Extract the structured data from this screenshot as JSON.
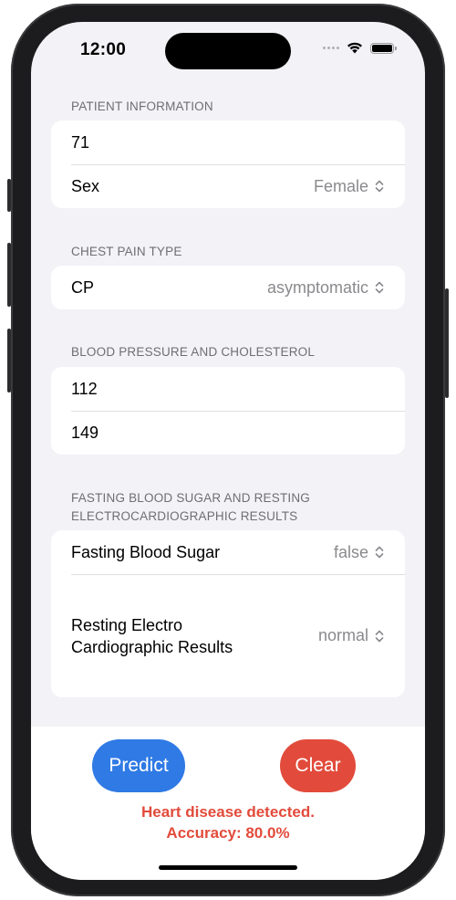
{
  "status_bar": {
    "time": "12:00",
    "icons": [
      "signal-dots-icon",
      "wifi-icon",
      "battery-icon"
    ]
  },
  "sections": {
    "patient": {
      "header": "PATIENT INFORMATION",
      "age_value": "71",
      "sex_label": "Sex",
      "sex_value": "Female"
    },
    "chest_pain": {
      "header": "CHEST PAIN TYPE",
      "cp_label": "CP",
      "cp_value": "asymptomatic"
    },
    "blood": {
      "header": "BLOOD PRESSURE AND CHOLESTEROL",
      "pressure_value": "112",
      "cholesterol_value": "149"
    },
    "fasting": {
      "header": "FASTING BLOOD SUGAR AND RESTING ELECTROCARDIOGRAPHIC RESULTS",
      "fbs_label": "Fasting Blood Sugar",
      "fbs_value": "false",
      "ecg_label_line1": "Resting Electro",
      "ecg_label_line2": "Cardiographic Results",
      "ecg_value": "normal"
    }
  },
  "actions": {
    "predict_label": "Predict",
    "clear_label": "Clear"
  },
  "result": {
    "line1": "Heart disease detected.",
    "line2": "Accuracy: 80.0%"
  },
  "colors": {
    "accent_blue": "#2f7ae5",
    "danger_red": "#e24b3b",
    "background": "#f2f2f7"
  }
}
